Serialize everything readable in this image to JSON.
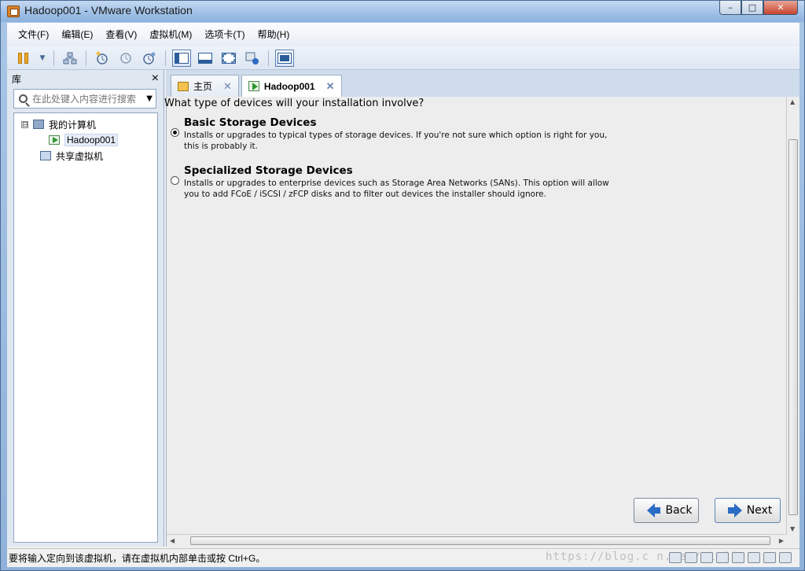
{
  "window": {
    "title": "Hadoop001 - VMware Workstation",
    "controls": {
      "minimize": "–",
      "maximize": "□",
      "close": "✕"
    }
  },
  "menubar": {
    "items": [
      "文件(F)",
      "编辑(E)",
      "查看(V)",
      "虚拟机(M)",
      "选项卡(T)",
      "帮助(H)"
    ]
  },
  "library": {
    "title": "库",
    "close": "×",
    "search_placeholder": "在此处键入内容进行搜索",
    "tree": {
      "my_computer": "我的计算机",
      "vm": "Hadoop001",
      "shared": "共享虚拟机",
      "expander": "⊟"
    }
  },
  "tabs": [
    {
      "label": "主页",
      "close": "✕"
    },
    {
      "label": "Hadoop001",
      "close": "✕"
    }
  ],
  "installer": {
    "question": "What type of devices will your installation involve?",
    "options": [
      {
        "title": "Basic Storage Devices",
        "description_line1": "Installs or upgrades to typical types of storage devices.  If you're not sure which option is right for you,",
        "description_line2": "this is probably it.",
        "selected": true
      },
      {
        "title": "Specialized Storage Devices",
        "description_line1": "Installs or upgrades to enterprise devices such as Storage Area Networks (SANs). This option will allow",
        "description_line2": "you to add FCoE / iSCSI / zFCP disks and to filter out devices the installer should ignore.",
        "selected": false
      }
    ],
    "back_label": "Back",
    "next_label": "Next"
  },
  "statusbar": {
    "text": "要将输入定向到该虚拟机，请在虚拟机内部单击或按 Ctrl+G。",
    "watermark": "https://blog.c   n.net/  1   21"
  },
  "colors": {
    "titlebar": "#9ebfe6",
    "accent_blue": "#2b6cc4",
    "guest_bg": "#ededed"
  }
}
